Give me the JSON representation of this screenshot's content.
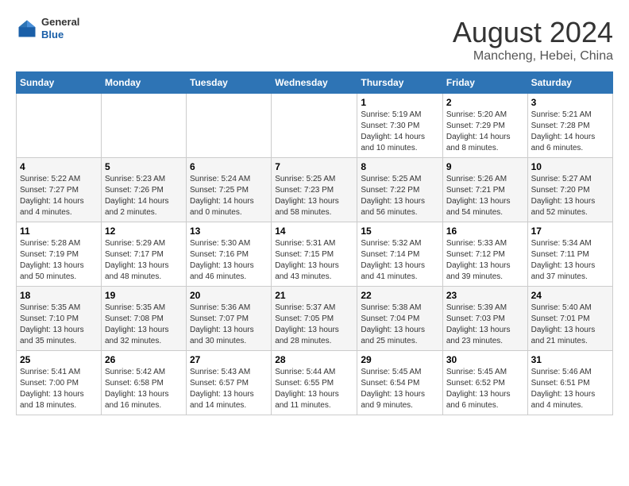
{
  "header": {
    "title": "August 2024",
    "subtitle": "Mancheng, Hebei, China",
    "logo_general": "General",
    "logo_blue": "Blue"
  },
  "weekdays": [
    "Sunday",
    "Monday",
    "Tuesday",
    "Wednesday",
    "Thursday",
    "Friday",
    "Saturday"
  ],
  "weeks": [
    [
      {
        "day": "",
        "info": ""
      },
      {
        "day": "",
        "info": ""
      },
      {
        "day": "",
        "info": ""
      },
      {
        "day": "",
        "info": ""
      },
      {
        "day": "1",
        "info": "Sunrise: 5:19 AM\nSunset: 7:30 PM\nDaylight: 14 hours\nand 10 minutes."
      },
      {
        "day": "2",
        "info": "Sunrise: 5:20 AM\nSunset: 7:29 PM\nDaylight: 14 hours\nand 8 minutes."
      },
      {
        "day": "3",
        "info": "Sunrise: 5:21 AM\nSunset: 7:28 PM\nDaylight: 14 hours\nand 6 minutes."
      }
    ],
    [
      {
        "day": "4",
        "info": "Sunrise: 5:22 AM\nSunset: 7:27 PM\nDaylight: 14 hours\nand 4 minutes."
      },
      {
        "day": "5",
        "info": "Sunrise: 5:23 AM\nSunset: 7:26 PM\nDaylight: 14 hours\nand 2 minutes."
      },
      {
        "day": "6",
        "info": "Sunrise: 5:24 AM\nSunset: 7:25 PM\nDaylight: 14 hours\nand 0 minutes."
      },
      {
        "day": "7",
        "info": "Sunrise: 5:25 AM\nSunset: 7:23 PM\nDaylight: 13 hours\nand 58 minutes."
      },
      {
        "day": "8",
        "info": "Sunrise: 5:25 AM\nSunset: 7:22 PM\nDaylight: 13 hours\nand 56 minutes."
      },
      {
        "day": "9",
        "info": "Sunrise: 5:26 AM\nSunset: 7:21 PM\nDaylight: 13 hours\nand 54 minutes."
      },
      {
        "day": "10",
        "info": "Sunrise: 5:27 AM\nSunset: 7:20 PM\nDaylight: 13 hours\nand 52 minutes."
      }
    ],
    [
      {
        "day": "11",
        "info": "Sunrise: 5:28 AM\nSunset: 7:19 PM\nDaylight: 13 hours\nand 50 minutes."
      },
      {
        "day": "12",
        "info": "Sunrise: 5:29 AM\nSunset: 7:17 PM\nDaylight: 13 hours\nand 48 minutes."
      },
      {
        "day": "13",
        "info": "Sunrise: 5:30 AM\nSunset: 7:16 PM\nDaylight: 13 hours\nand 46 minutes."
      },
      {
        "day": "14",
        "info": "Sunrise: 5:31 AM\nSunset: 7:15 PM\nDaylight: 13 hours\nand 43 minutes."
      },
      {
        "day": "15",
        "info": "Sunrise: 5:32 AM\nSunset: 7:14 PM\nDaylight: 13 hours\nand 41 minutes."
      },
      {
        "day": "16",
        "info": "Sunrise: 5:33 AM\nSunset: 7:12 PM\nDaylight: 13 hours\nand 39 minutes."
      },
      {
        "day": "17",
        "info": "Sunrise: 5:34 AM\nSunset: 7:11 PM\nDaylight: 13 hours\nand 37 minutes."
      }
    ],
    [
      {
        "day": "18",
        "info": "Sunrise: 5:35 AM\nSunset: 7:10 PM\nDaylight: 13 hours\nand 35 minutes."
      },
      {
        "day": "19",
        "info": "Sunrise: 5:35 AM\nSunset: 7:08 PM\nDaylight: 13 hours\nand 32 minutes."
      },
      {
        "day": "20",
        "info": "Sunrise: 5:36 AM\nSunset: 7:07 PM\nDaylight: 13 hours\nand 30 minutes."
      },
      {
        "day": "21",
        "info": "Sunrise: 5:37 AM\nSunset: 7:05 PM\nDaylight: 13 hours\nand 28 minutes."
      },
      {
        "day": "22",
        "info": "Sunrise: 5:38 AM\nSunset: 7:04 PM\nDaylight: 13 hours\nand 25 minutes."
      },
      {
        "day": "23",
        "info": "Sunrise: 5:39 AM\nSunset: 7:03 PM\nDaylight: 13 hours\nand 23 minutes."
      },
      {
        "day": "24",
        "info": "Sunrise: 5:40 AM\nSunset: 7:01 PM\nDaylight: 13 hours\nand 21 minutes."
      }
    ],
    [
      {
        "day": "25",
        "info": "Sunrise: 5:41 AM\nSunset: 7:00 PM\nDaylight: 13 hours\nand 18 minutes."
      },
      {
        "day": "26",
        "info": "Sunrise: 5:42 AM\nSunset: 6:58 PM\nDaylight: 13 hours\nand 16 minutes."
      },
      {
        "day": "27",
        "info": "Sunrise: 5:43 AM\nSunset: 6:57 PM\nDaylight: 13 hours\nand 14 minutes."
      },
      {
        "day": "28",
        "info": "Sunrise: 5:44 AM\nSunset: 6:55 PM\nDaylight: 13 hours\nand 11 minutes."
      },
      {
        "day": "29",
        "info": "Sunrise: 5:45 AM\nSunset: 6:54 PM\nDaylight: 13 hours\nand 9 minutes."
      },
      {
        "day": "30",
        "info": "Sunrise: 5:45 AM\nSunset: 6:52 PM\nDaylight: 13 hours\nand 6 minutes."
      },
      {
        "day": "31",
        "info": "Sunrise: 5:46 AM\nSunset: 6:51 PM\nDaylight: 13 hours\nand 4 minutes."
      }
    ]
  ]
}
